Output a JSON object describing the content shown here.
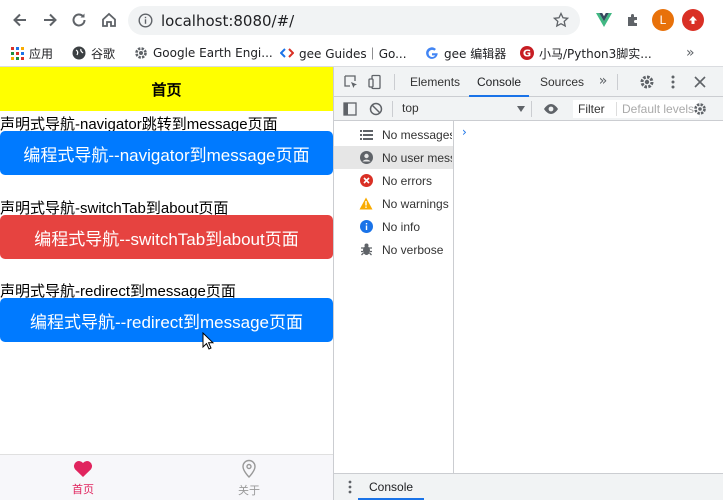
{
  "browser": {
    "url": "localhost:8080/#/",
    "profile_initial": "L"
  },
  "bookmarks": [
    {
      "label": "应用",
      "icon": "apps-grid-icon"
    },
    {
      "label": "谷歌",
      "icon": "globe-icon"
    },
    {
      "label": "Google Earth Engi...",
      "icon": "gear-icon"
    },
    {
      "label": "gee Guides｜Go...",
      "icon": "code-icon"
    },
    {
      "label": "gee 编辑器",
      "icon": "google-g-icon"
    },
    {
      "label": "小马/Python3脚实...",
      "icon": "gitee-icon"
    }
  ],
  "app": {
    "header_title": "首页",
    "rows": [
      {
        "declarative": "声明式导航-navigator跳转到message页面",
        "button": "编程式导航--navigator到message页面",
        "color": "#007aff"
      },
      {
        "declarative": "声明式导航-switchTab到about页面",
        "button": "编程式导航--switchTab到about页面",
        "color": "#e64340"
      },
      {
        "declarative": "声明式导航-redirect到message页面",
        "button": "编程式导航--redirect到message页面",
        "color": "#007aff"
      }
    ],
    "tabbar": [
      {
        "label": "首页",
        "icon": "heart-icon",
        "active": true
      },
      {
        "label": "关于",
        "icon": "location-icon",
        "active": false
      }
    ]
  },
  "devtools": {
    "tabs": [
      "Elements",
      "Console",
      "Sources"
    ],
    "active_tab": "Console",
    "context": "top",
    "filter_placeholder": "Filter",
    "level": "Default levels",
    "sidebar": [
      {
        "label": "No messages",
        "icon": "list-icon"
      },
      {
        "label": "No user messages",
        "icon": "user-icon"
      },
      {
        "label": "No errors",
        "icon": "error-icon"
      },
      {
        "label": "No warnings",
        "icon": "warning-icon"
      },
      {
        "label": "No info",
        "icon": "info-icon"
      },
      {
        "label": "No verbose",
        "icon": "bug-icon"
      }
    ],
    "drawer_tab": "Console"
  }
}
